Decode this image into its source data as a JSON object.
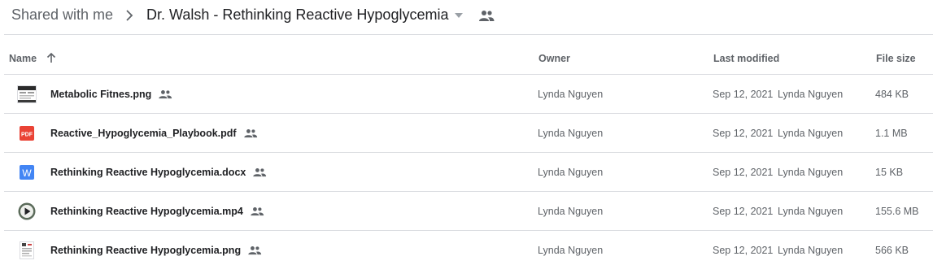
{
  "breadcrumb": {
    "root": "Shared with me",
    "current": "Dr. Walsh - Rethinking Reactive Hypoglycemia"
  },
  "columns": {
    "name": "Name",
    "owner": "Owner",
    "last_modified": "Last modified",
    "file_size": "File size"
  },
  "sort": {
    "column": "name",
    "direction": "ascending",
    "icon": "arrow-up-icon"
  },
  "files": [
    {
      "name": "Metabolic Fitnes.png",
      "type": "image-thumbnail",
      "owner": "Lynda Nguyen",
      "modified_date": "Sep 12, 2021",
      "modified_by": "Lynda Nguyen",
      "size": "484 KB"
    },
    {
      "name": "Reactive_Hypoglycemia_Playbook.pdf",
      "type": "pdf",
      "owner": "Lynda Nguyen",
      "modified_date": "Sep 12, 2021",
      "modified_by": "Lynda Nguyen",
      "size": "1.1 MB"
    },
    {
      "name": "Rethinking Reactive Hypoglycemia.docx",
      "type": "word",
      "owner": "Lynda Nguyen",
      "modified_date": "Sep 12, 2021",
      "modified_by": "Lynda Nguyen",
      "size": "15 KB"
    },
    {
      "name": "Rethinking Reactive Hypoglycemia.mp4",
      "type": "video",
      "owner": "Lynda Nguyen",
      "modified_date": "Sep 12, 2021",
      "modified_by": "Lynda Nguyen",
      "size": "155.6 MB"
    },
    {
      "name": "Rethinking Reactive Hypoglycemia.png",
      "type": "image-thumbnail",
      "owner": "Lynda Nguyen",
      "modified_date": "Sep 12, 2021",
      "modified_by": "Lynda Nguyen",
      "size": "566 KB"
    }
  ],
  "icons": {
    "shared": "people-icon",
    "pdf_label": "PDF",
    "word_label": "W"
  },
  "colors": {
    "pdf": "#ea4335",
    "word": "#4285f4",
    "video": "#5b6b5a",
    "divider": "#dadce0",
    "muted_text": "#5f6368"
  }
}
